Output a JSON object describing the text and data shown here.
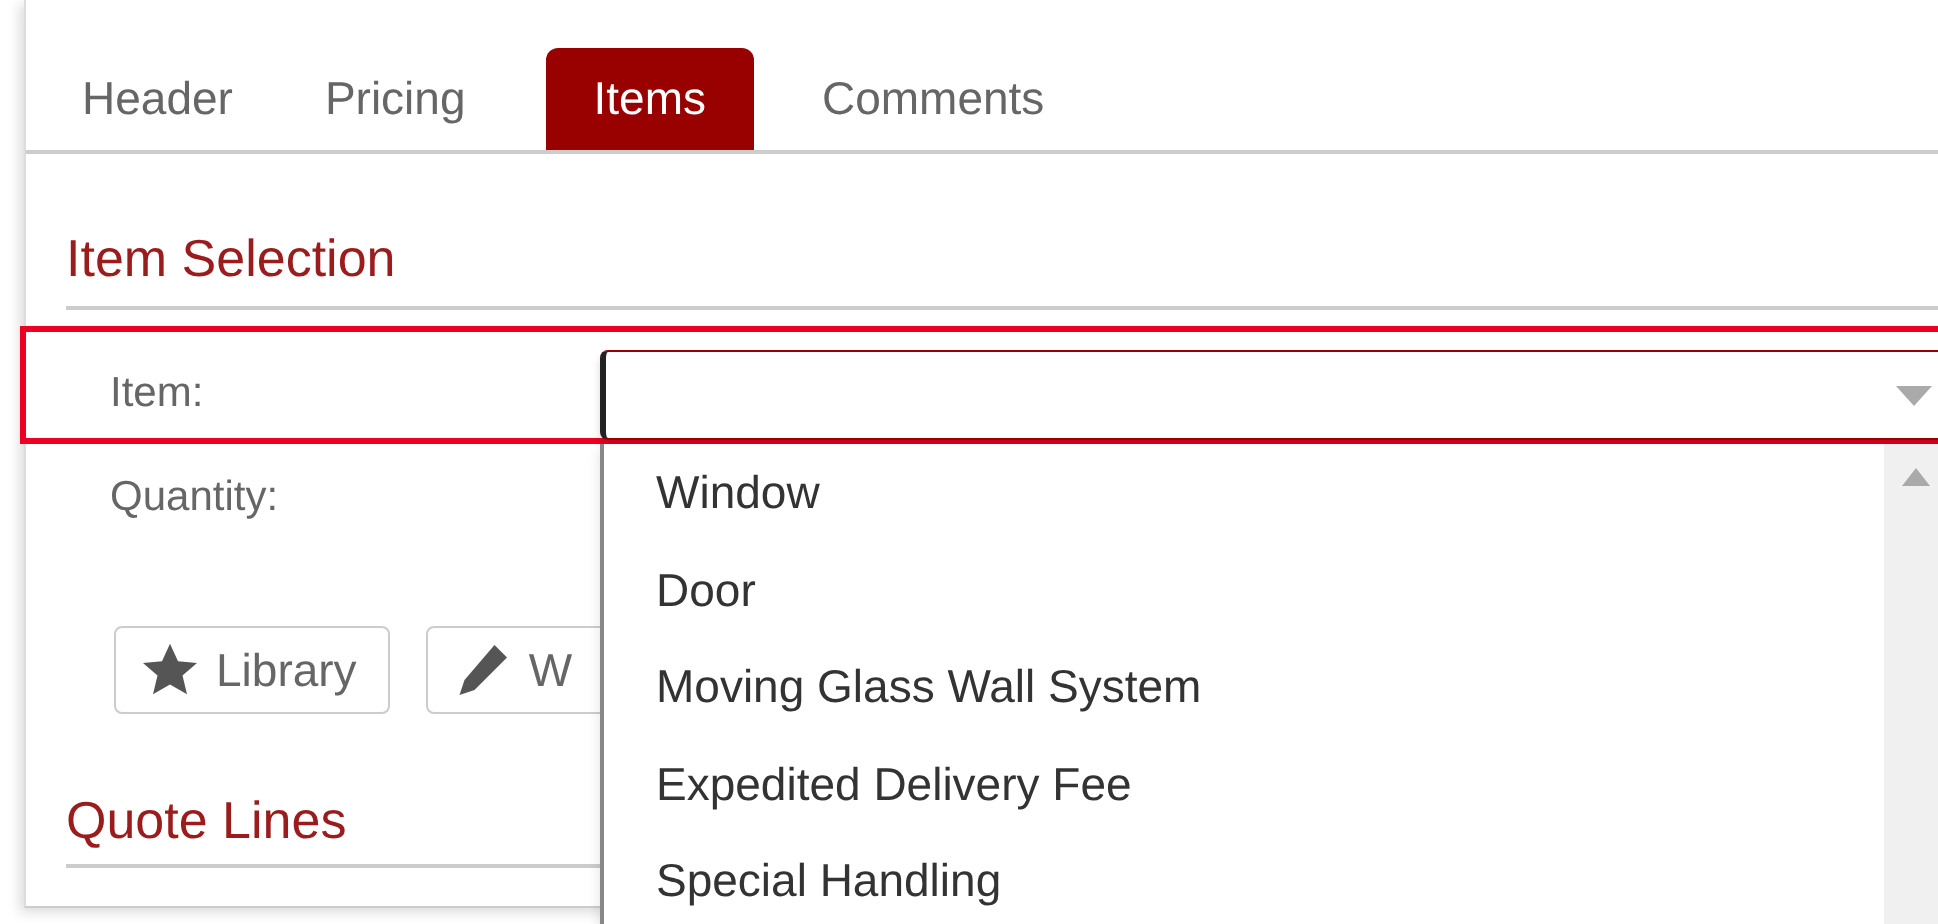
{
  "tabs": [
    {
      "label": "Header",
      "selected": false
    },
    {
      "label": "Pricing",
      "selected": false
    },
    {
      "label": "Items",
      "selected": true
    },
    {
      "label": "Comments",
      "selected": false
    }
  ],
  "item_selection": {
    "title": "Item Selection",
    "fields": [
      {
        "label": "Item:"
      },
      {
        "label": "Quantity:"
      }
    ],
    "buttons": [
      {
        "label": "Library",
        "kind": "star"
      },
      {
        "label": "W",
        "kind": "pencil"
      }
    ]
  },
  "item_dropdown": {
    "options": [
      "Window",
      "Door",
      "Moving Glass Wall System",
      "Expedited Delivery Fee",
      "Special Handling"
    ]
  },
  "quote_lines": {
    "title": "Quote Lines"
  }
}
